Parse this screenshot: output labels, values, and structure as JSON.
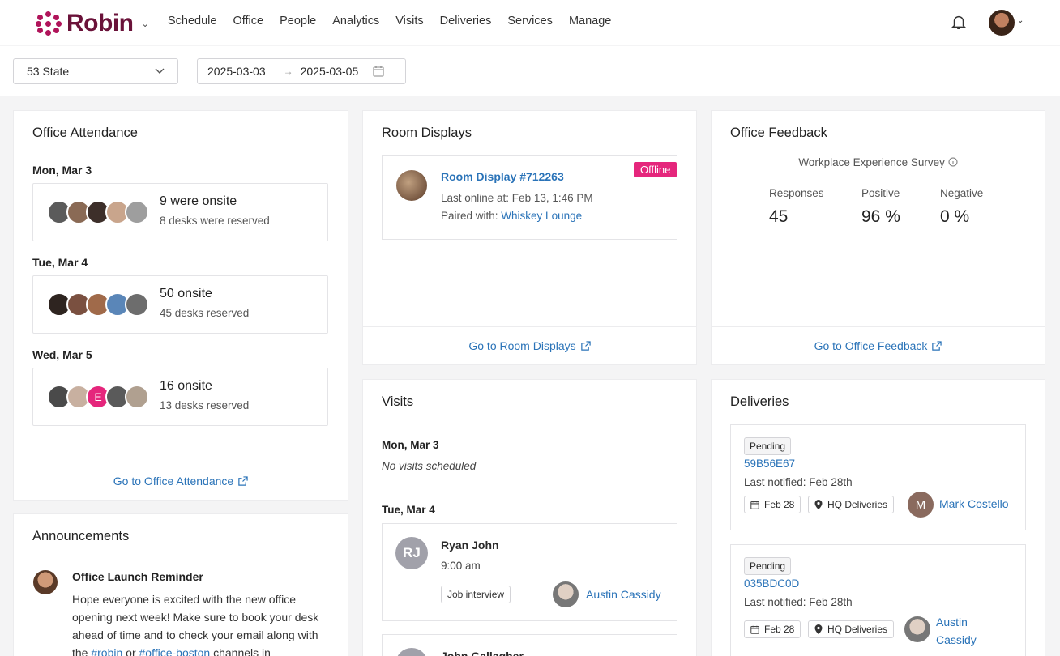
{
  "brand": {
    "name": "Robin"
  },
  "nav": [
    "Schedule",
    "Office",
    "People",
    "Analytics",
    "Visits",
    "Deliveries",
    "Services",
    "Manage"
  ],
  "filters": {
    "location": "53 State",
    "start_date": "2025-03-03",
    "end_date": "2025-03-05"
  },
  "attendance": {
    "title": "Office Attendance",
    "days": [
      {
        "label": "Mon, Mar 3",
        "main": "9 were onsite",
        "sub": "8 desks were reserved"
      },
      {
        "label": "Tue, Mar 4",
        "main": "50 onsite",
        "sub": "45 desks reserved"
      },
      {
        "label": "Wed, Mar 5",
        "main": "16 onsite",
        "sub": "13 desks reserved"
      }
    ],
    "avatar_initial": "E",
    "footer": "Go to Office Attendance"
  },
  "room_displays": {
    "title": "Room Displays",
    "name": "Room Display #712263",
    "last_online": "Last online at: Feb 13, 1:46 PM",
    "paired_prefix": "Paired with: ",
    "paired_room": "Whiskey Lounge",
    "status": "Offline",
    "footer": "Go to Room Displays"
  },
  "feedback": {
    "title": "Office Feedback",
    "survey": "Workplace Experience Survey",
    "responses_label": "Responses",
    "responses": "45",
    "positive_label": "Positive",
    "positive": "96 %",
    "negative_label": "Negative",
    "negative": "0 %",
    "footer": "Go to Office Feedback"
  },
  "announcements": {
    "title": "Announcements",
    "item_title": "Office Launch Reminder",
    "body_1": "Hope everyone is excited with the new office opening next week! Make sure to book your desk ahead of time and to check your email along with the ",
    "channel_1": "#robin",
    "body_2": " or ",
    "channel_2": "#office-boston",
    "body_3": " channels in"
  },
  "visits": {
    "title": "Visits",
    "day1": "Mon, Mar 3",
    "day1_none": "No visits scheduled",
    "day2": "Tue, Mar 4",
    "visitor_initials": "RJ",
    "visitor": "Ryan John",
    "time": "9:00 am",
    "purpose": "Job interview",
    "host": "Austin Cassidy",
    "next_visitor": "John Gallagher"
  },
  "deliveries": {
    "title": "Deliveries",
    "items": [
      {
        "status": "Pending",
        "id": "59B56E67",
        "note": "Last notified: Feb 28th",
        "date": "Feb 28",
        "location": "HQ Deliveries",
        "recipient_initial": "M",
        "recipient": "Mark Costello"
      },
      {
        "status": "Pending",
        "id": "035BDC0D",
        "note": "Last notified: Feb 28th",
        "date": "Feb 28",
        "location": "HQ Deliveries",
        "recipient_line1": "Austin",
        "recipient_line2": "Cassidy"
      }
    ]
  }
}
